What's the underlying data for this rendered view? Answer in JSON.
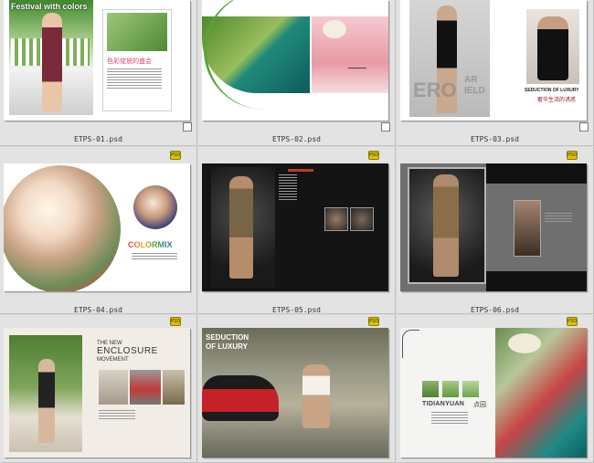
{
  "files": [
    {
      "name": "ETPS-01.psd"
    },
    {
      "name": "ETPS-02.psd"
    },
    {
      "name": "ETPS-03.psd"
    },
    {
      "name": "ETPS-04.psd"
    },
    {
      "name": "ETPS-05.psd"
    },
    {
      "name": "ETPS-06.psd"
    }
  ],
  "badge_text": "PSD",
  "page_text": {
    "p1_title": "Festival with colors",
    "p1_chinese": "色彩绽放的盛会",
    "p3_big": "ERO",
    "p3_big2": "AR",
    "p3_big3": "IELD",
    "p3_caption": "SEDUCTION OF LUXURY",
    "p3_caption_cn": "奢华生活的诱惑",
    "p4_title": "COLORMIX",
    "p7_the_new": "THE NEW",
    "p7_enclosure": "ENCLOSURE",
    "p7_movement": "MOVEMENT",
    "p8_title1": "SEDUCTION",
    "p8_title2": "OF LUXURY",
    "p9_brand": "TIDIANYUAN",
    "p9_brand_cn": "点园"
  },
  "colors": {
    "background": "#d9d9d9",
    "cell": "#e3e3e3",
    "accent_pink": "#d9476d",
    "accent_green": "#5aa33b",
    "dark_page": "#141414"
  }
}
